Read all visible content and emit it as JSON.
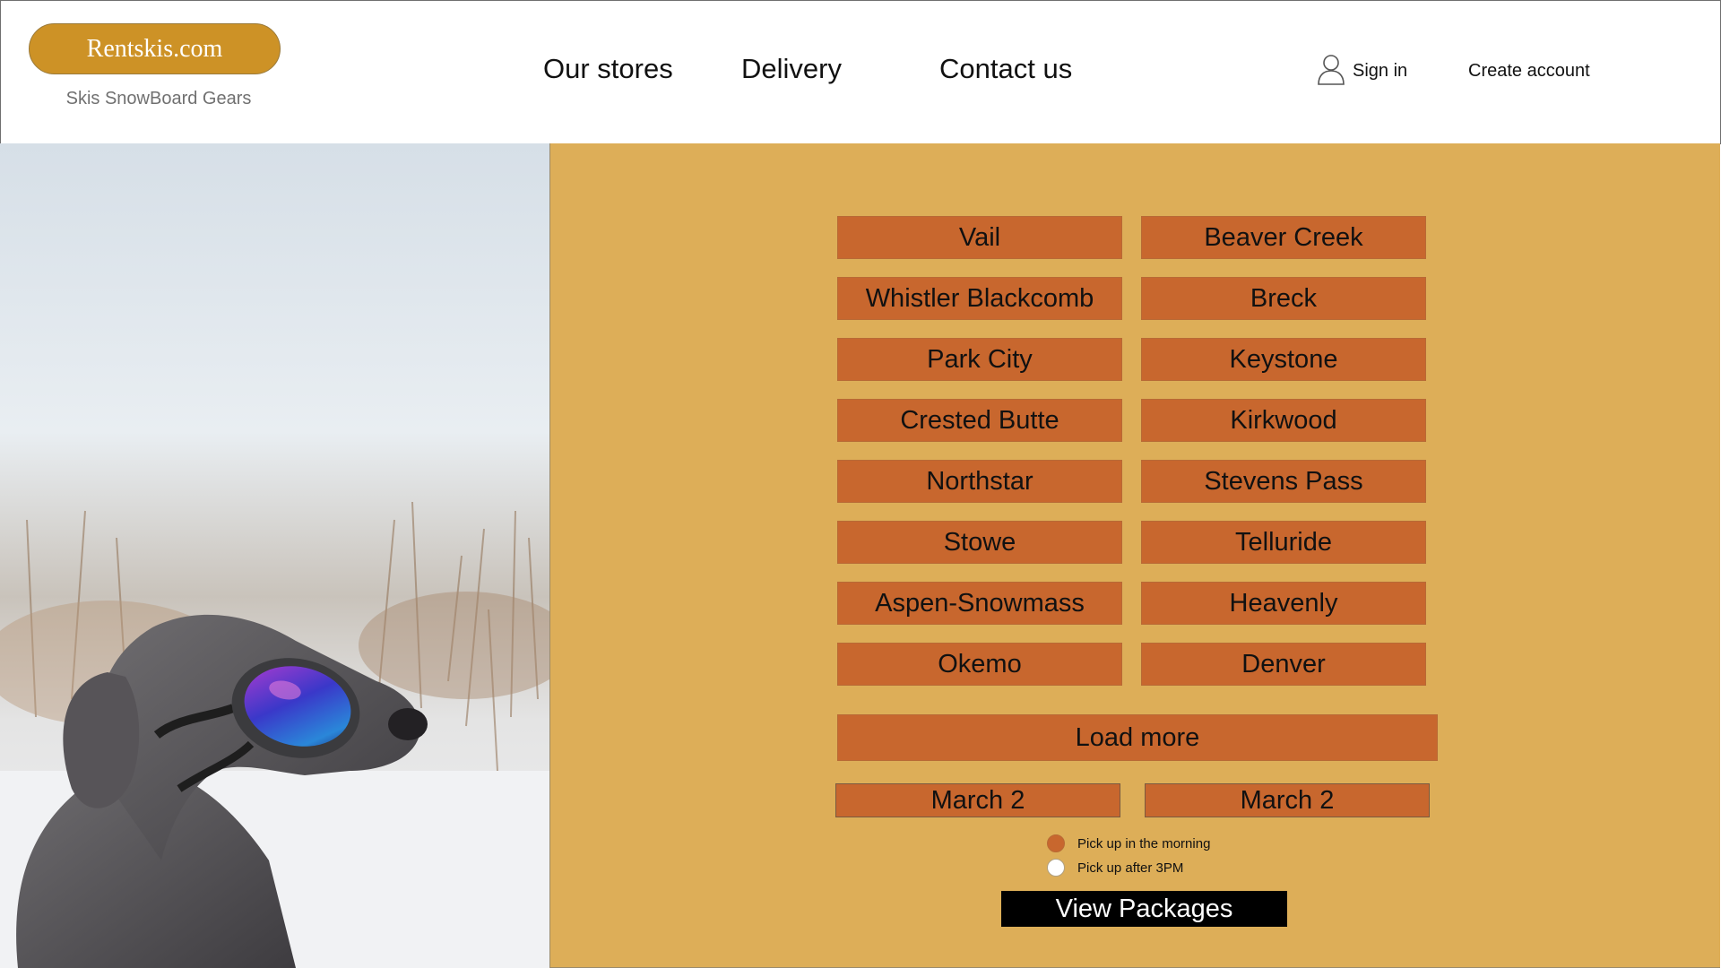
{
  "brand": {
    "logo_text": "Rentskis.com",
    "tagline": "Skis SnowBoard Gears",
    "logo_color": "#cd9226"
  },
  "nav": {
    "our_stores": "Our stores",
    "delivery": "Delivery",
    "contact_us": "Contact us",
    "sign_in": "Sign in",
    "create_account": "Create account"
  },
  "hero_image": {
    "icon": "dog-wearing-ski-goggles-photo"
  },
  "stores": {
    "left": [
      "Vail",
      "Whistler Blackcomb",
      "Park City",
      "Crested Butte",
      "Northstar",
      "Stowe",
      "Aspen-Snowmass",
      "Okemo"
    ],
    "right": [
      "Beaver Creek",
      "Breck",
      "Keystone",
      "Kirkwood",
      "Stevens Pass",
      "Telluride",
      "Heavenly",
      "Denver"
    ]
  },
  "load_more": "Load more",
  "dates": {
    "start": "March 2",
    "end": "March 2"
  },
  "pickup": {
    "morning": "Pick up in the morning",
    "afternoon": "Pick up after 3PM",
    "selected": "morning"
  },
  "view_packages": "View Packages",
  "colors": {
    "panel_bg": "#ddae58",
    "button_bg": "#c8672e",
    "cta_bg": "#000000"
  }
}
